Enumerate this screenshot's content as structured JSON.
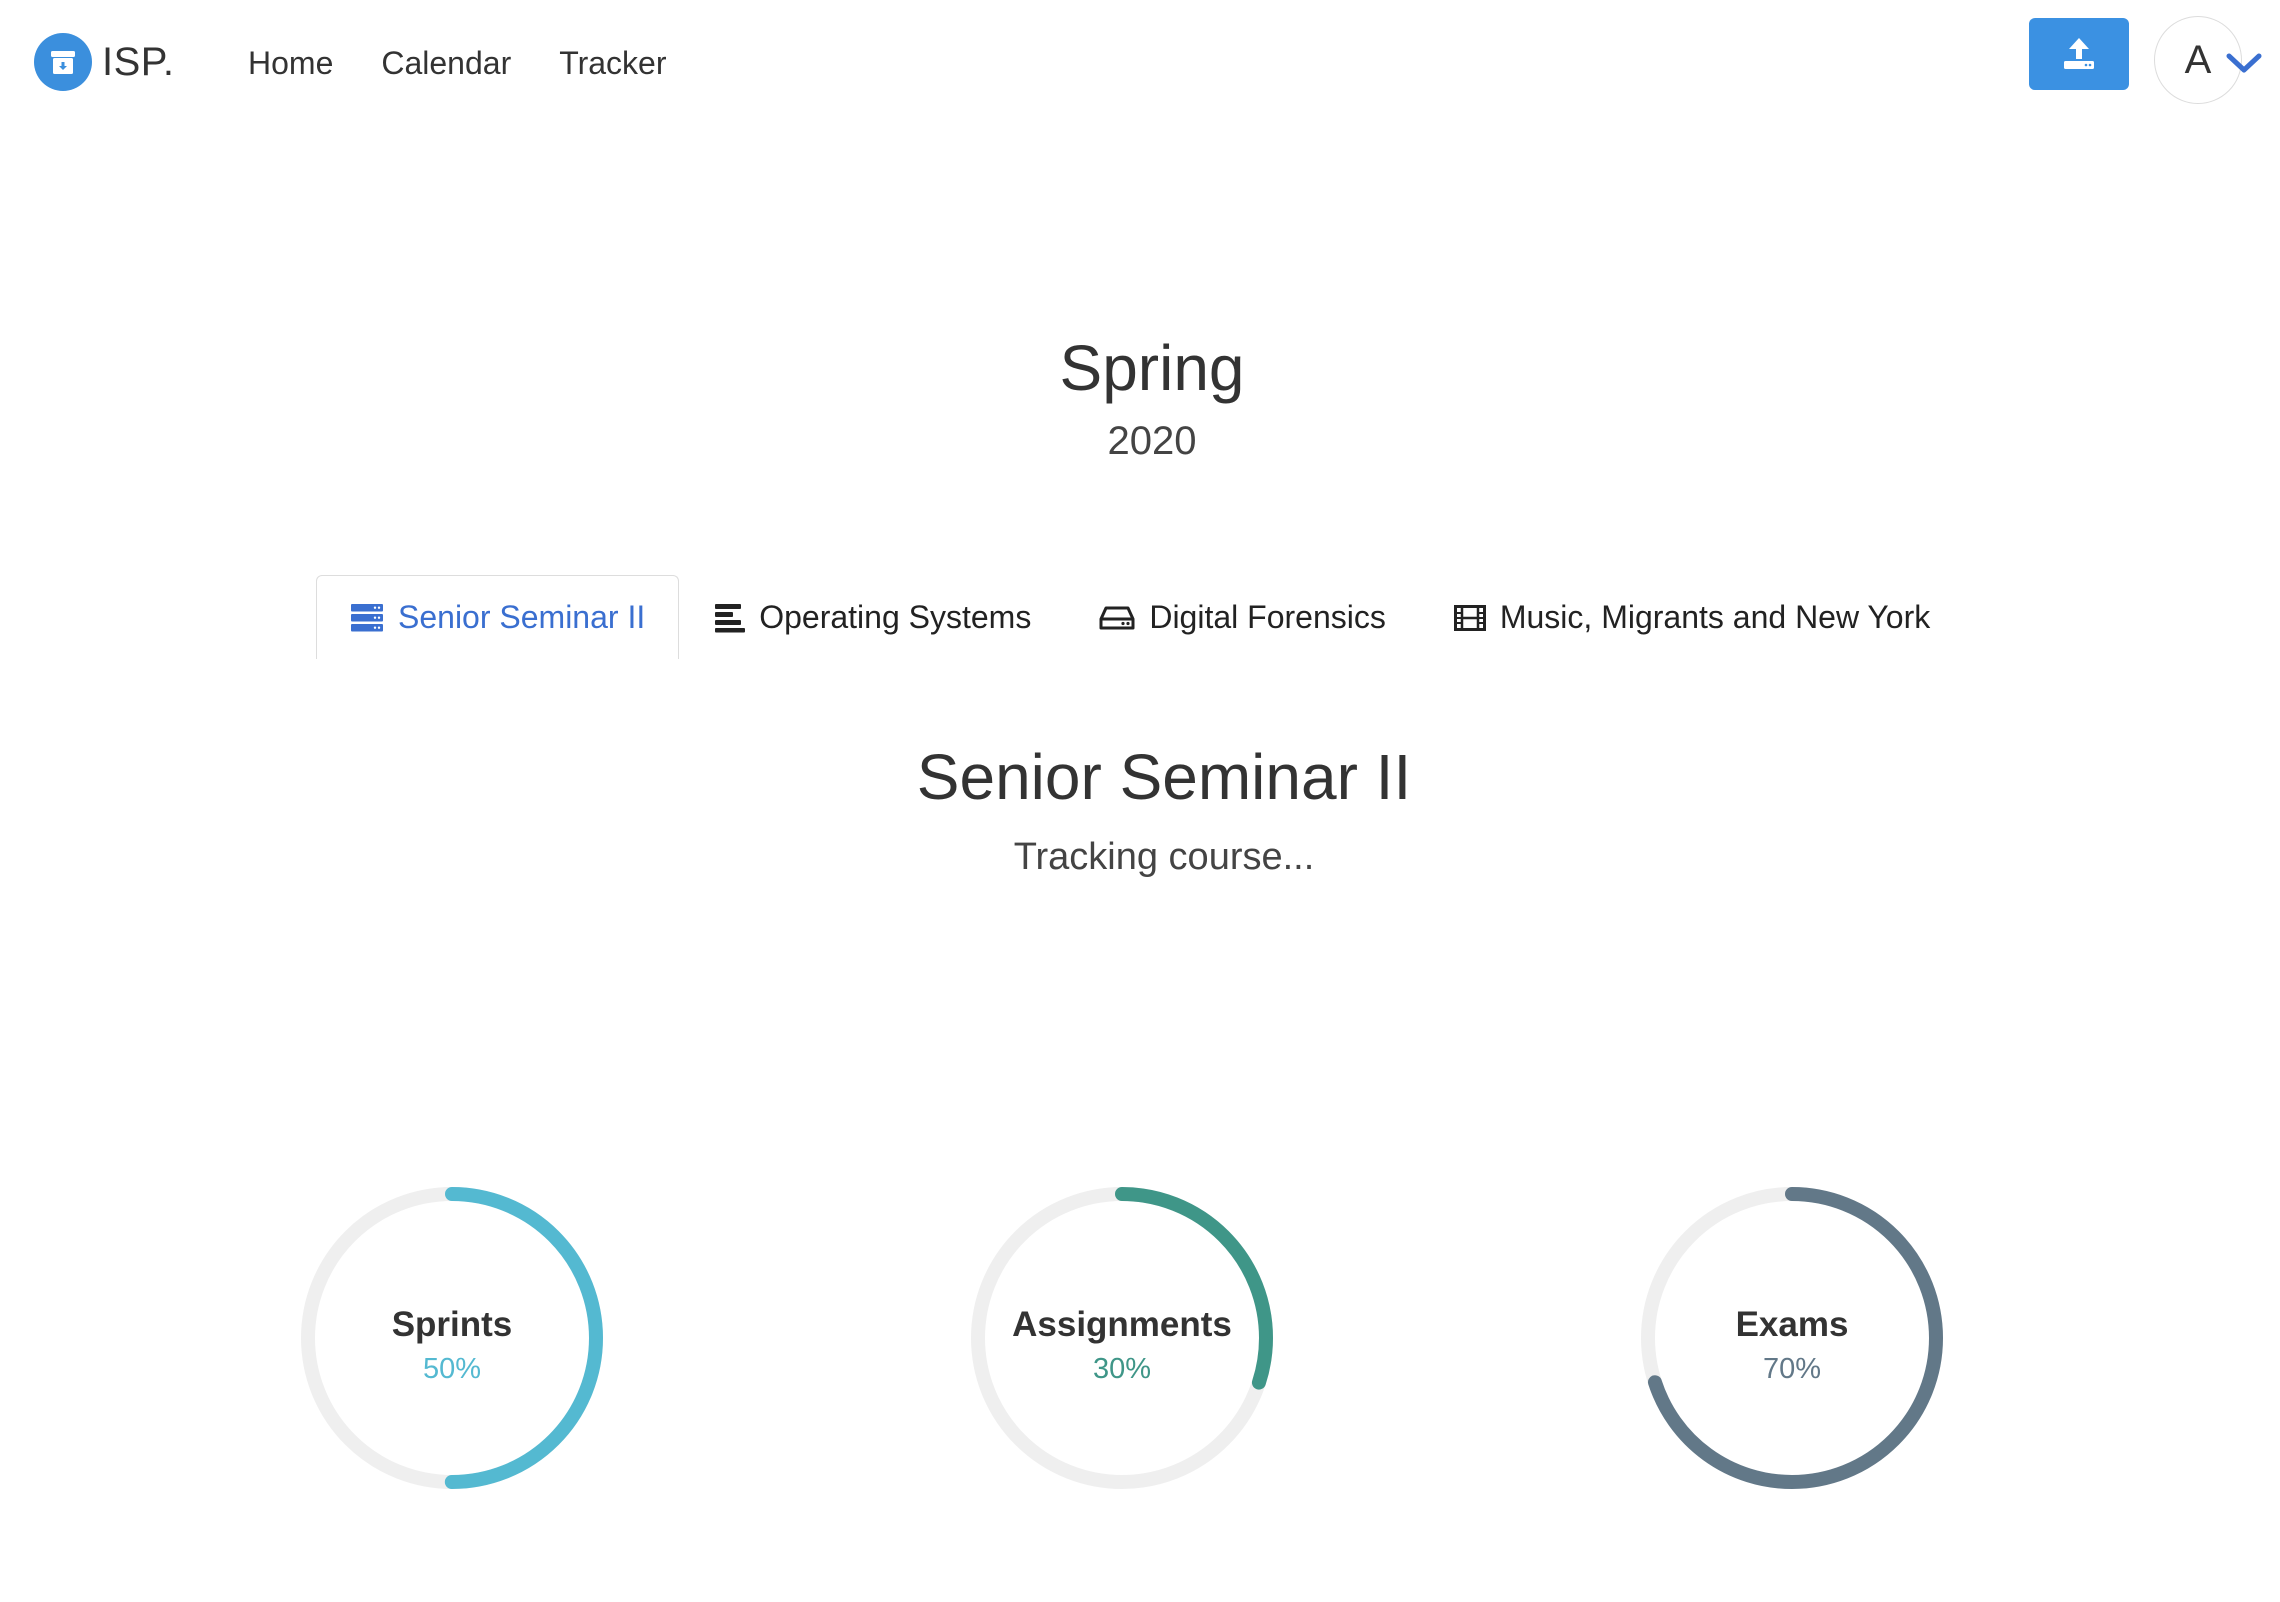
{
  "navbar": {
    "brand": "ISP.",
    "links": [
      "Home",
      "Calendar",
      "Tracker"
    ],
    "upload_icon": "upload-icon",
    "avatar_initial": "A",
    "accent": "#3b91e2"
  },
  "term": {
    "season": "Spring",
    "year": "2020"
  },
  "tabs": [
    {
      "label": "Senior Seminar II",
      "icon": "server-icon",
      "active": true
    },
    {
      "label": "Operating Systems",
      "icon": "align-left-icon",
      "active": false
    },
    {
      "label": "Digital Forensics",
      "icon": "hdd-icon",
      "active": false
    },
    {
      "label": "Music, Migrants and New York",
      "icon": "film-icon",
      "active": false
    }
  ],
  "course": {
    "title": "Senior Seminar II",
    "subtitle": "Tracking course..."
  },
  "progress": [
    {
      "label": "Sprints",
      "value_text": "50%",
      "fraction": 0.5,
      "color": "#54b9d1"
    },
    {
      "label": "Assignments",
      "value_text": "30%",
      "fraction": 0.3,
      "color": "#3f9688"
    },
    {
      "label": "Exams",
      "value_text": "70%",
      "fraction": 0.7,
      "color": "#627888"
    }
  ],
  "ring_track_color": "#efefef"
}
